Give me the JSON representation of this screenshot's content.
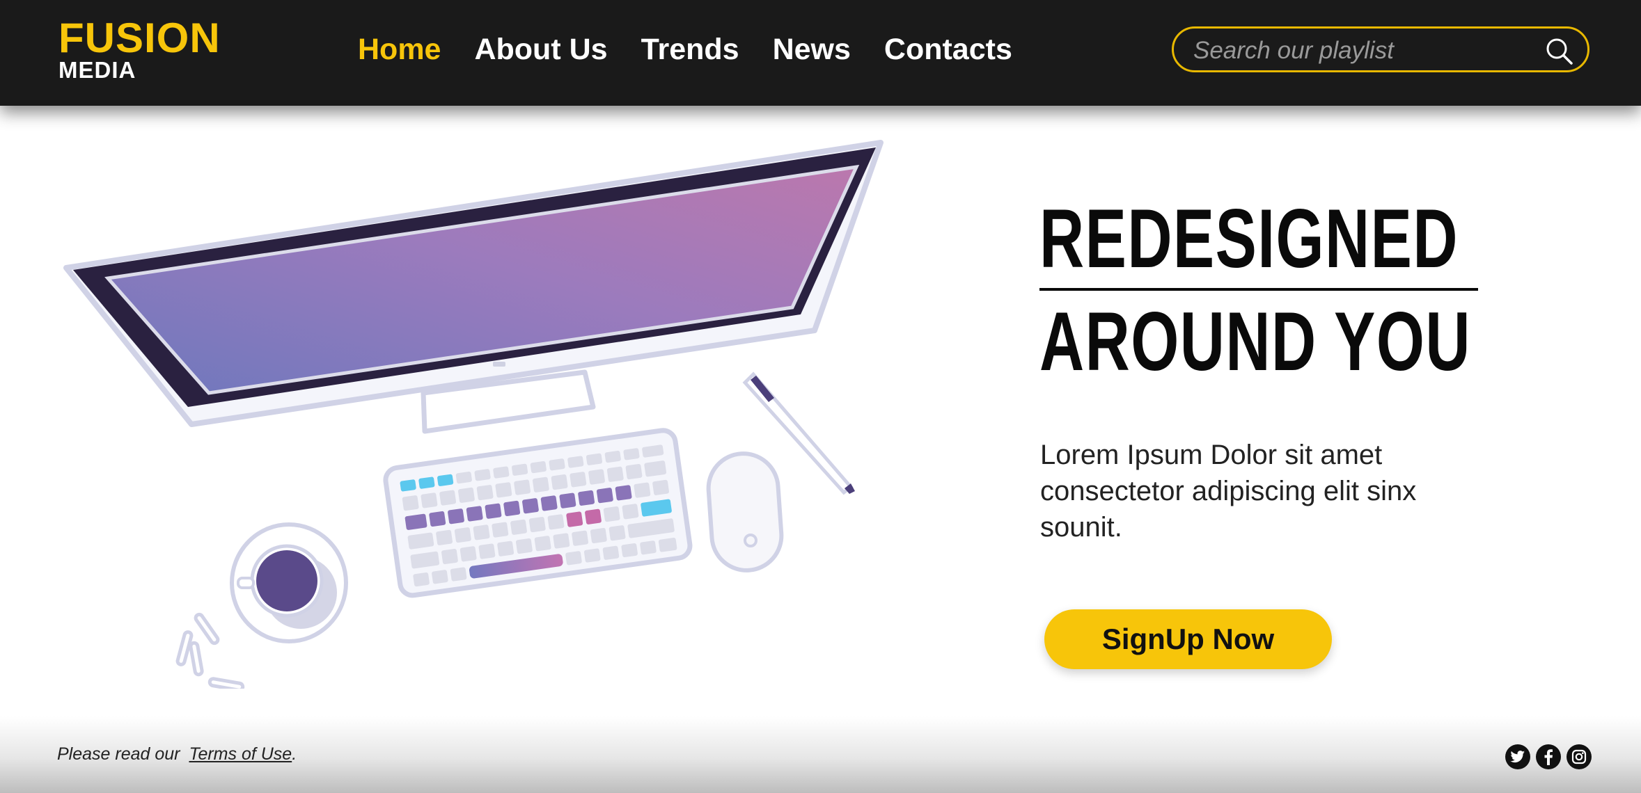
{
  "brand": {
    "name_top": "FUSION",
    "name_bottom": "MEDIA",
    "accent_color": "#f7c50a",
    "header_bg": "#1a1a1a"
  },
  "nav": {
    "items": [
      {
        "label": "Home",
        "active": true
      },
      {
        "label": "About Us",
        "active": false
      },
      {
        "label": "Trends",
        "active": false
      },
      {
        "label": "News",
        "active": false
      },
      {
        "label": "Contacts",
        "active": false
      }
    ]
  },
  "search": {
    "placeholder": "Search our playlist",
    "value": "",
    "icon": "search-icon"
  },
  "hero": {
    "headline_line1": "REDESIGNED",
    "headline_line2": "AROUND YOU",
    "body": "Lorem Ipsum Dolor sit amet consectetor adipiscing elit sinx sounit.",
    "cta_label": "SignUp Now",
    "illustration": "desk-illustration"
  },
  "footer": {
    "prefix": "Please read our",
    "link_label": "Terms of Use",
    "suffix": ".",
    "social": [
      "twitter-icon",
      "facebook-icon",
      "instagram-icon"
    ]
  }
}
